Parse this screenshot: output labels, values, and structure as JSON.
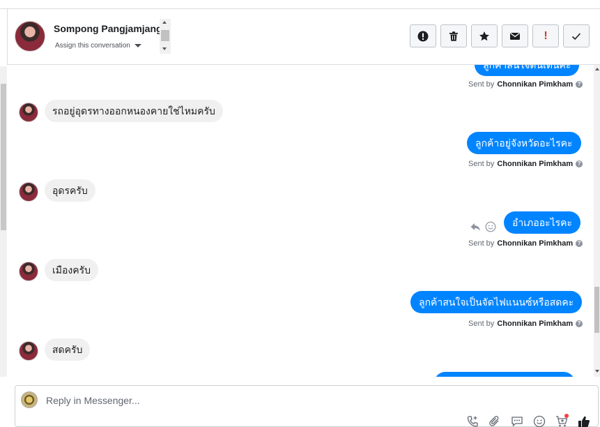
{
  "header": {
    "contact_name": "Sompong Pangjamjang",
    "assign_label": "Assign this conversation",
    "actions": [
      {
        "name": "spam-button",
        "icon": "alert-circle-icon"
      },
      {
        "name": "delete-button",
        "icon": "trash-icon"
      },
      {
        "name": "star-button",
        "icon": "star-icon"
      },
      {
        "name": "mark-unread-button",
        "icon": "envelope-icon"
      },
      {
        "name": "follow-up-button",
        "icon": "exclamation-icon",
        "label": "!"
      },
      {
        "name": "mark-done-button",
        "icon": "checkmark-icon"
      }
    ]
  },
  "messages": {
    "sent_by_prefix": "Sent by",
    "agent_name": "Chonnikan Pimkham",
    "out_1_partial": "ลูกค้าสนใจดีนเตนคะ",
    "in_1": "รถอยู่อุดรทางออกหนองคายใช่ไหมครับ",
    "out_2": "ลูกค้าอยู่จังหวัดอะไรคะ",
    "in_2": "อุดรครับ",
    "out_3": "อำเภออะไรคะ",
    "in_3": "เมืองครับ",
    "out_4": "ลูกค้าสนใจเป็นจัดไฟแนนซ์หรือสดคะ",
    "in_4": "สดครับ"
  },
  "composer": {
    "placeholder": "Reply in Messenger...",
    "tools": [
      "phone-icon",
      "paperclip-icon",
      "saved-reply-icon",
      "emoji-icon",
      "cart-icon",
      "thumbs-up-icon"
    ]
  },
  "colors": {
    "outgoing_bubble": "#0084ff",
    "incoming_bubble": "#f1f0f0",
    "follow_up_red": "#d8322d"
  }
}
